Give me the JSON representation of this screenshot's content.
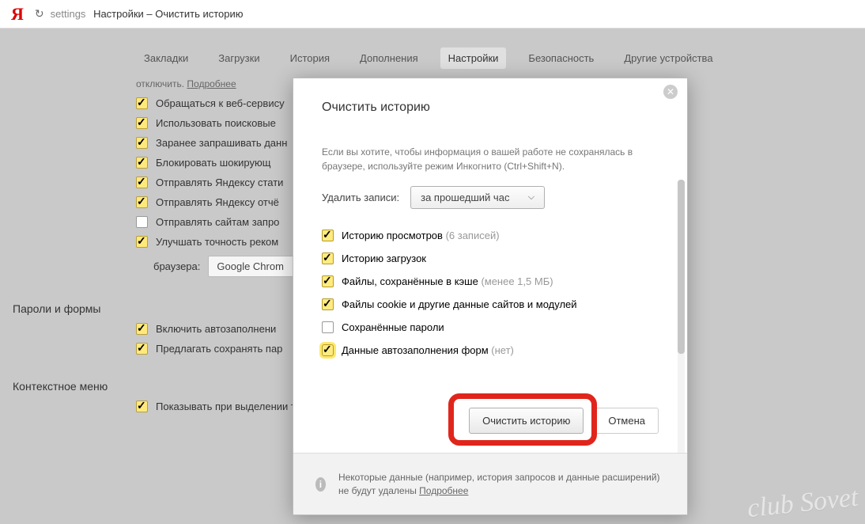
{
  "addressBar": {
    "logo": "Я",
    "urlPrefix": "settings",
    "urlTitle": "Настройки – Очистить историю"
  },
  "tabs": [
    {
      "label": "Закладки"
    },
    {
      "label": "Загрузки"
    },
    {
      "label": "История"
    },
    {
      "label": "Дополнения"
    },
    {
      "label": "Настройки",
      "active": true
    },
    {
      "label": "Безопасность"
    },
    {
      "label": "Другие устройства"
    }
  ],
  "settings": {
    "hintPrefix": "отключить.",
    "hintLink": "Подробнее",
    "options": [
      {
        "checked": true,
        "label": "Обращаться к веб-сервису"
      },
      {
        "checked": true,
        "label": "Использовать поисковые"
      },
      {
        "checked": true,
        "label": "Заранее запрашивать данн"
      },
      {
        "checked": true,
        "label": "Блокировать шокирующ"
      },
      {
        "checked": true,
        "label": "Отправлять Яндексу стати"
      },
      {
        "checked": true,
        "label": "Отправлять Яндексу отчё"
      },
      {
        "checked": false,
        "label": "Отправлять сайтам запро"
      },
      {
        "checked": true,
        "label": "Улучшать точность реком"
      }
    ],
    "browserLabel": "браузера:",
    "browserValue": "Google Chrom",
    "sectionPasswords": "Пароли и формы",
    "passwordsOpts": [
      {
        "checked": true,
        "label": "Включить автозаполнени"
      },
      {
        "checked": true,
        "label": "Предлагать сохранять пар"
      }
    ],
    "sectionContext": "Контекстное меню",
    "contextOpt": {
      "checked": true,
      "label": "Показывать при выделении текста кнопки «Найти» и «Копировать»"
    }
  },
  "modal": {
    "title": "Очистить историю",
    "hint": "Если вы хотите, чтобы информация о вашей работе не сохранялась в браузере, используйте режим Инкогнито (Ctrl+Shift+N).",
    "deleteLabel": "Удалить записи:",
    "periodSelected": "за прошедший час",
    "items": [
      {
        "checked": true,
        "label": "Историю просмотров",
        "suffix": "(6 записей)"
      },
      {
        "checked": true,
        "label": "Историю загрузок",
        "suffix": ""
      },
      {
        "checked": true,
        "label": "Файлы, сохранённые в кэше",
        "suffix": "(менее 1,5 МБ)"
      },
      {
        "checked": true,
        "label": "Файлы cookie и другие данные сайтов и модулей",
        "suffix": ""
      },
      {
        "checked": false,
        "label": "Сохранённые пароли",
        "suffix": ""
      },
      {
        "checked": true,
        "label": "Данные автозаполнения форм",
        "suffix": "(нет)",
        "highlight": true
      }
    ],
    "primaryBtn": "Очистить историю",
    "cancelBtn": "Отмена",
    "infoText": "Некоторые данные (например, история запросов и данные расширений) не будут удалены",
    "infoLink": "Подробнее"
  },
  "watermark": "club Sovet"
}
